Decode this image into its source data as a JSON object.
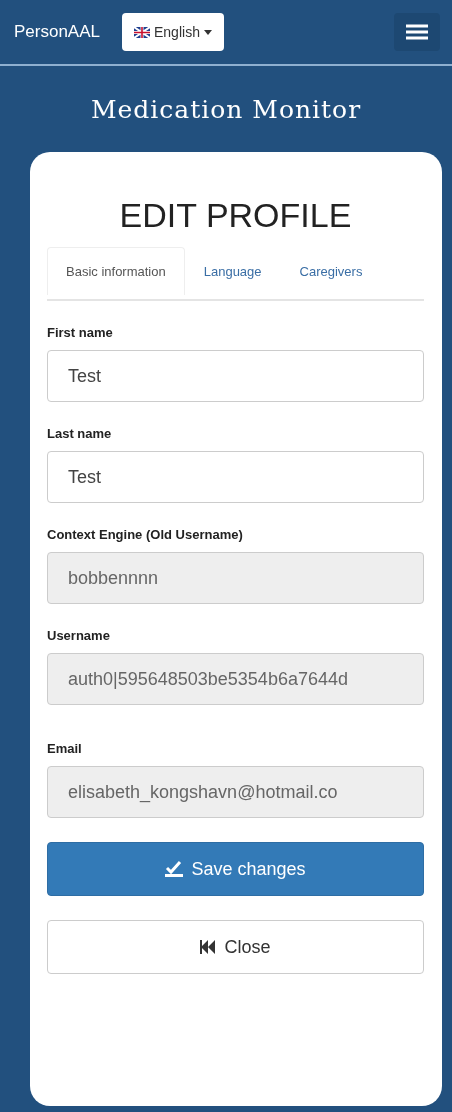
{
  "navbar": {
    "brand": "PersonAAL",
    "language": "English"
  },
  "app_title": "Medication Monitor",
  "heading": "EDIT PROFILE",
  "tabs": [
    {
      "label": "Basic information",
      "selected": true
    },
    {
      "label": "Language",
      "selected": false
    },
    {
      "label": "Caregivers",
      "selected": false
    }
  ],
  "fields": [
    {
      "label": "First name",
      "value": "Test",
      "disabled": false
    },
    {
      "label": "Last name",
      "value": "Test",
      "disabled": false
    },
    {
      "label": "Context Engine (Old Username)",
      "value": "bobbennnn",
      "disabled": true
    },
    {
      "label": "Username",
      "value": "auth0|595648503be5354b6a7644d",
      "disabled": true
    },
    {
      "label": "Email",
      "value": "elisabeth_kongshavn@hotmail.co",
      "disabled": true
    }
  ],
  "buttons": [
    {
      "kind": "primary",
      "label": "Save changes"
    },
    {
      "kind": "default",
      "label": "Close"
    }
  ]
}
